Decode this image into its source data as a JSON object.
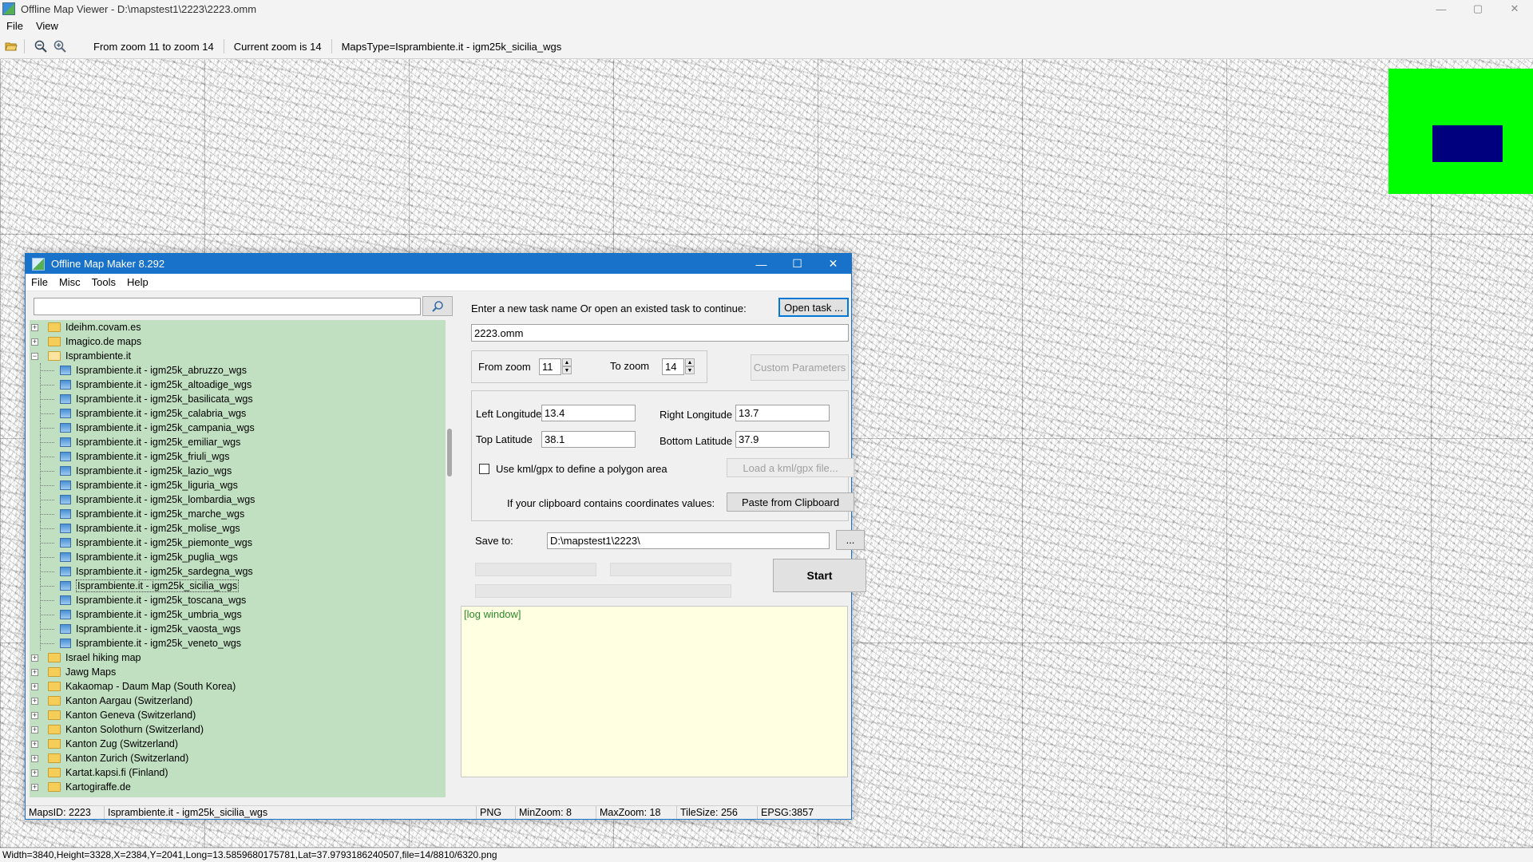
{
  "viewer": {
    "title": "Offline Map Viewer - D:\\mapstest1\\2223\\2223.omm",
    "window_controls": {
      "minimize": "—",
      "maximize": "▢",
      "close": "✕"
    },
    "menu": [
      "File",
      "View"
    ],
    "toolbar": {
      "icons": [
        "open-folder-icon",
        "zoom-out-icon",
        "zoom-in-icon"
      ],
      "zoom_range_text": "From zoom 11 to zoom 14",
      "current_zoom_text": "Current zoom is 14",
      "maps_type_text": "MapsType=Isprambiente.it - igm25k_sicilia_wgs"
    },
    "statusbar": "Width=3840,Height=3328,X=2384,Y=2041,Long=13.5859680175781,Lat=37.9793186240507,file=14/8810/6320.png",
    "minimap_colors": {
      "background": "#00ff00",
      "viewport": "#00007f"
    }
  },
  "dialog": {
    "title": "Offline Map Maker 8.292",
    "window_controls": {
      "minimize": "—",
      "maximize": "☐",
      "close": "✕"
    },
    "menu": [
      "File",
      "Misc",
      "Tools",
      "Help"
    ],
    "search": {
      "value": "",
      "icon": "search-icon"
    },
    "tree": [
      {
        "label": "Ideihm.covam.es",
        "type": "folder",
        "expanded": false
      },
      {
        "label": "Imagico.de maps",
        "type": "folder",
        "expanded": false
      },
      {
        "label": "Isprambiente.it",
        "type": "folder",
        "expanded": true
      },
      {
        "label": "Isprambiente.it - igm25k_abruzzo_wgs",
        "type": "map"
      },
      {
        "label": "Isprambiente.it - igm25k_altoadige_wgs",
        "type": "map"
      },
      {
        "label": "Isprambiente.it - igm25k_basilicata_wgs",
        "type": "map"
      },
      {
        "label": "Isprambiente.it - igm25k_calabria_wgs",
        "type": "map"
      },
      {
        "label": "Isprambiente.it - igm25k_campania_wgs",
        "type": "map"
      },
      {
        "label": "Isprambiente.it - igm25k_emiliar_wgs",
        "type": "map"
      },
      {
        "label": "Isprambiente.it - igm25k_friuli_wgs",
        "type": "map"
      },
      {
        "label": "Isprambiente.it - igm25k_lazio_wgs",
        "type": "map"
      },
      {
        "label": "Isprambiente.it - igm25k_liguria_wgs",
        "type": "map"
      },
      {
        "label": "Isprambiente.it - igm25k_lombardia_wgs",
        "type": "map"
      },
      {
        "label": "Isprambiente.it - igm25k_marche_wgs",
        "type": "map"
      },
      {
        "label": "Isprambiente.it - igm25k_molise_wgs",
        "type": "map"
      },
      {
        "label": "Isprambiente.it - igm25k_piemonte_wgs",
        "type": "map"
      },
      {
        "label": "Isprambiente.it - igm25k_puglia_wgs",
        "type": "map"
      },
      {
        "label": "Isprambiente.it - igm25k_sardegna_wgs",
        "type": "map"
      },
      {
        "label": "Isprambiente.it - igm25k_sicilia_wgs",
        "type": "map",
        "selected": true
      },
      {
        "label": "Isprambiente.it - igm25k_toscana_wgs",
        "type": "map"
      },
      {
        "label": "Isprambiente.it - igm25k_umbria_wgs",
        "type": "map"
      },
      {
        "label": "Isprambiente.it - igm25k_vaosta_wgs",
        "type": "map"
      },
      {
        "label": "Isprambiente.it - igm25k_veneto_wgs",
        "type": "map"
      },
      {
        "label": "Israel hiking map",
        "type": "folder",
        "expanded": false
      },
      {
        "label": "Jawg Maps",
        "type": "folder",
        "expanded": false
      },
      {
        "label": "Kakaomap - Daum Map (South Korea)",
        "type": "folder",
        "expanded": false
      },
      {
        "label": "Kanton Aargau (Switzerland)",
        "type": "folder",
        "expanded": false
      },
      {
        "label": "Kanton Geneva (Switzerland)",
        "type": "folder",
        "expanded": false
      },
      {
        "label": "Kanton Solothurn (Switzerland)",
        "type": "folder",
        "expanded": false
      },
      {
        "label": "Kanton Zug (Switzerland)",
        "type": "folder",
        "expanded": false
      },
      {
        "label": "Kanton Zurich (Switzerland)",
        "type": "folder",
        "expanded": false
      },
      {
        "label": "Kartat.kapsi.fi (Finland)",
        "type": "folder",
        "expanded": false
      },
      {
        "label": "Kartogiraffe.de",
        "type": "folder",
        "expanded": false
      }
    ],
    "task": {
      "prompt": "Enter a new task name Or open an existed task to continue:",
      "open_button": "Open task ...",
      "name_value": "2223.omm"
    },
    "zoom": {
      "from_label": "From zoom",
      "from_value": "11",
      "to_label": "To zoom",
      "to_value": "14",
      "custom_button": "Custom Parameters"
    },
    "coords": {
      "left_lon_label": "Left Longitude",
      "left_lon_value": "13.4",
      "right_lon_label": "Right Longitude",
      "right_lon_value": "13.7",
      "top_lat_label": "Top Latitude",
      "top_lat_value": "38.1",
      "bottom_lat_label": "Bottom Latitude",
      "bottom_lat_value": "37.9",
      "kml_checkbox_label": "Use kml/gpx to define a polygon area",
      "kml_checked": false,
      "load_kml_button": "Load a kml/gpx file...",
      "clipboard_label": "If your clipboard contains coordinates values:",
      "paste_button": "Paste from Clipboard"
    },
    "save": {
      "label": "Save to:",
      "value": "D:\\mapstest1\\2223\\",
      "browse_button": "..."
    },
    "start_button": "Start",
    "log_text": "[log window]",
    "statusbar": {
      "maps_id": "MapsID: 2223",
      "maps_name": "Isprambiente.it - igm25k_sicilia_wgs",
      "format": "PNG",
      "min_zoom": "MinZoom: 8",
      "max_zoom": "MaxZoom: 18",
      "tile_size": "TileSize: 256",
      "epsg": "EPSG:3857"
    }
  }
}
